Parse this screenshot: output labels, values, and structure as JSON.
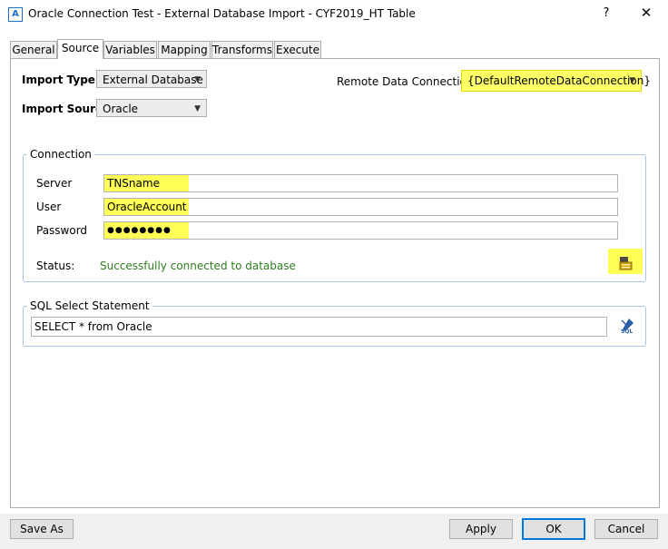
{
  "window": {
    "title": "Oracle Connection Test - External Database Import - CYF2019_HT Table",
    "app_icon_letter": "A",
    "help_glyph": "?",
    "close_glyph": "✕"
  },
  "tabs": [
    {
      "label": "General",
      "active": false
    },
    {
      "label": "Source",
      "active": true
    },
    {
      "label": "Variables",
      "active": false
    },
    {
      "label": "Mapping",
      "active": false
    },
    {
      "label": "Transforms",
      "active": false
    },
    {
      "label": "Execute",
      "active": false
    }
  ],
  "source": {
    "import_type_label": "Import Type",
    "import_type_value": "External Database",
    "import_source_label": "Import Source",
    "import_source_value": "Oracle",
    "remote_connection_label": "Remote Data Connection",
    "remote_connection_value": "{DefaultRemoteDataConnection}"
  },
  "connection": {
    "group_title": "Connection",
    "server_label": "Server",
    "server_value": "TNSname",
    "user_label": "User",
    "user_value": "OracleAccount",
    "password_label": "Password",
    "password_value": "●●●●●●●●",
    "status_label": "Status:",
    "status_value": "Successfully connected to database"
  },
  "sql": {
    "group_title": "SQL Select Statement",
    "statement": "SELECT * from Oracle",
    "editor_icon_text": "SQL"
  },
  "footer": {
    "save_as": "Save As",
    "apply": "Apply",
    "ok": "OK",
    "cancel": "Cancel"
  },
  "colors": {
    "highlight": "#ffff55",
    "status_ok": "#2e7d1e",
    "accent": "#0078d7"
  }
}
